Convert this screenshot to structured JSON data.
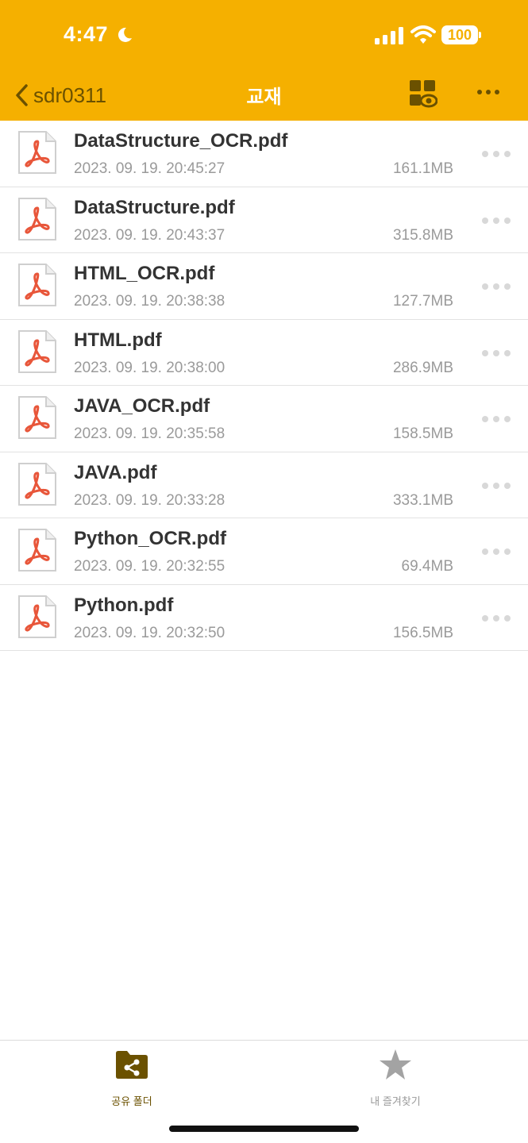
{
  "status_bar": {
    "time": "4:47",
    "battery": "100",
    "moon_icon": "moon-icon",
    "signal_icon": "cellular-signal-icon",
    "wifi_icon": "wifi-icon"
  },
  "nav": {
    "back_label": "sdr0311",
    "title": "교재",
    "view_icon": "grid-view-eye-icon",
    "more_icon": "more-horizontal-icon"
  },
  "colors": {
    "accent": "#f5b000",
    "back_text": "#6b5100",
    "pdf_red": "#e8563a"
  },
  "files": [
    {
      "name": "DataStructure_OCR.pdf",
      "date": "2023. 09. 19. 20:45:27",
      "size": "161.1MB"
    },
    {
      "name": "DataStructure.pdf",
      "date": "2023. 09. 19. 20:43:37",
      "size": "315.8MB"
    },
    {
      "name": "HTML_OCR.pdf",
      "date": "2023. 09. 19. 20:38:38",
      "size": "127.7MB"
    },
    {
      "name": "HTML.pdf",
      "date": "2023. 09. 19. 20:38:00",
      "size": "286.9MB"
    },
    {
      "name": "JAVA_OCR.pdf",
      "date": "2023. 09. 19. 20:35:58",
      "size": "158.5MB"
    },
    {
      "name": "JAVA.pdf",
      "date": "2023. 09. 19. 20:33:28",
      "size": "333.1MB"
    },
    {
      "name": "Python_OCR.pdf",
      "date": "2023. 09. 19. 20:32:55",
      "size": "69.4MB"
    },
    {
      "name": "Python.pdf",
      "date": "2023. 09. 19. 20:32:50",
      "size": "156.5MB"
    }
  ],
  "tabs": {
    "shared": {
      "label": "공유 폴더",
      "icon": "shared-folder-icon"
    },
    "favorites": {
      "label": "내 즐겨찾기",
      "icon": "star-icon"
    }
  }
}
